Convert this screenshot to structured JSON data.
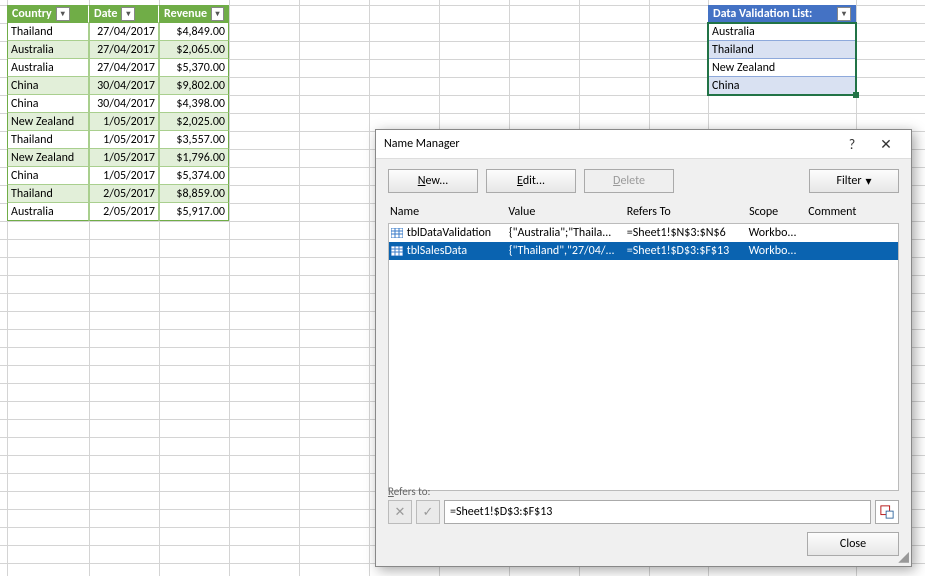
{
  "sales_table": {
    "columns": [
      "Country",
      "Date",
      "Revenue"
    ],
    "rows": [
      {
        "country": "Thailand",
        "date": "27/04/2017",
        "revenue": "$4,849.00"
      },
      {
        "country": "Australia",
        "date": "27/04/2017",
        "revenue": "$2,065.00"
      },
      {
        "country": "Australia",
        "date": "27/04/2017",
        "revenue": "$5,370.00"
      },
      {
        "country": "China",
        "date": "30/04/2017",
        "revenue": "$9,802.00"
      },
      {
        "country": "China",
        "date": "30/04/2017",
        "revenue": "$4,398.00"
      },
      {
        "country": "New Zealand",
        "date": "1/05/2017",
        "revenue": "$2,025.00"
      },
      {
        "country": "Thailand",
        "date": "1/05/2017",
        "revenue": "$3,557.00"
      },
      {
        "country": "New Zealand",
        "date": "1/05/2017",
        "revenue": "$1,796.00"
      },
      {
        "country": "China",
        "date": "1/05/2017",
        "revenue": "$5,374.00"
      },
      {
        "country": "Thailand",
        "date": "2/05/2017",
        "revenue": "$8,859.00"
      },
      {
        "country": "Australia",
        "date": "2/05/2017",
        "revenue": "$5,917.00"
      }
    ]
  },
  "validation_table": {
    "header": "Data Validation List:",
    "items": [
      "Australia",
      "Thailand",
      "New Zealand",
      "China"
    ]
  },
  "dialog": {
    "title": "Name Manager",
    "help_label": "?",
    "close_label": "✕",
    "toolbar": {
      "new": "New...",
      "edit": "Edit...",
      "delete": "Delete",
      "filter": "Filter"
    },
    "headers": {
      "name": "Name",
      "value": "Value",
      "refers": "Refers To",
      "scope": "Scope",
      "comment": "Comment"
    },
    "rows": [
      {
        "name": "tblDataValidation",
        "value": "{\"Australia\";\"Thaila...",
        "refers": "=Sheet1!$N$3:$N$6",
        "scope": "Workbo...",
        "comment": ""
      },
      {
        "name": "tblSalesData",
        "value": "{\"Thailand\",\"27/04/...",
        "refers": "=Sheet1!$D$3:$F$13",
        "scope": "Workbo...",
        "comment": ""
      }
    ],
    "selected_index": 1,
    "refers_label": "Refers to:",
    "refers_value": "=Sheet1!$D$3:$F$13",
    "close_btn": "Close"
  },
  "col_widths": {
    "sales": [
      82,
      70,
      70
    ],
    "val": [
      148
    ]
  }
}
